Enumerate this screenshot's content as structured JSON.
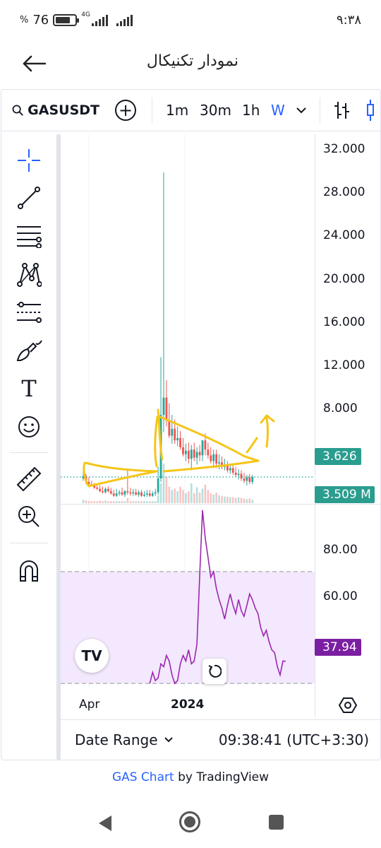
{
  "status_bar": {
    "time": "۹:۳۸",
    "battery": "76",
    "battery_percent_sign": "%",
    "battery_level": 0.76,
    "network": "4G"
  },
  "app_bar": {
    "title": "نمودار تکنیکال",
    "back_icon": "arrow-left-icon"
  },
  "toolbar": {
    "symbol": "GASUSDT",
    "intervals": [
      "1m",
      "30m",
      "1h",
      "W"
    ],
    "active_interval": "W",
    "icons": [
      "search-icon",
      "add-circle-icon",
      "chevron-down-icon",
      "bars-icon",
      "candles-icon"
    ]
  },
  "drawing_tools": [
    "crosshair-icon",
    "trendline-icon",
    "fib-retracement-icon",
    "pattern-icon",
    "prediction-icon",
    "brush-icon",
    "text-icon",
    "emoji-icon",
    "ruler-icon",
    "zoom-in-icon",
    "magnet-icon"
  ],
  "text_tool_label": "T",
  "chart_data": [
    {
      "type": "candlestick",
      "pane": "price",
      "y_ticks": [
        "32.000",
        "28.000",
        "24.000",
        "20.000",
        "16.000",
        "12.000",
        "8.000"
      ],
      "ylim": [
        1.3,
        33.3
      ],
      "x_ticks": [
        "Apr",
        "2024"
      ],
      "last_price": "3.626",
      "volume_label": "3.509 M",
      "up_color": "#26a69a",
      "down_color": "#ef5350",
      "price_tag_color": "#2a9d8f",
      "series": [
        {
          "name": "price",
          "x": [
            "2023-03-06",
            "2023-03-13",
            "2023-03-20",
            "2023-03-27",
            "2023-04-03",
            "2023-04-10",
            "2023-04-17",
            "2023-04-24",
            "2023-05-01",
            "2023-05-08",
            "2023-05-15",
            "2023-05-22",
            "2023-05-29",
            "2023-06-05",
            "2023-06-12",
            "2023-06-19",
            "2023-06-26",
            "2023-07-03",
            "2023-07-10",
            "2023-07-17",
            "2023-07-24",
            "2023-07-31",
            "2023-08-07",
            "2023-08-14",
            "2023-08-21",
            "2023-08-28",
            "2023-09-04",
            "2023-09-11",
            "2023-09-18",
            "2023-09-25",
            "2023-10-02",
            "2023-10-09",
            "2023-10-16",
            "2023-10-23",
            "2023-10-30",
            "2023-11-06",
            "2023-11-13",
            "2023-11-20",
            "2023-11-27",
            "2023-12-04",
            "2023-12-11",
            "2023-12-18",
            "2023-12-25",
            "2024-01-01",
            "2024-01-08",
            "2024-01-15",
            "2024-01-22",
            "2024-01-29",
            "2024-02-05",
            "2024-02-12",
            "2024-02-19",
            "2024-02-26",
            "2024-03-04",
            "2024-03-11",
            "2024-03-18",
            "2024-03-25",
            "2024-04-01",
            "2024-04-08",
            "2024-04-15",
            "2024-04-22",
            "2024-04-29",
            "2024-05-06"
          ],
          "open": [
            3.5,
            3.7,
            3.2,
            3.0,
            2.9,
            2.7,
            2.6,
            2.4,
            2.3,
            2.6,
            2.4,
            2.2,
            2.0,
            2.2,
            2.3,
            2.1,
            2.4,
            2.3,
            2.2,
            2.3,
            2.1,
            2.3,
            2.0,
            2.1,
            2.2,
            2.0,
            2.2,
            2.3,
            3.5,
            9.0,
            10.5,
            8.5,
            7.2,
            7.8,
            6.8,
            7.0,
            6.2,
            5.6,
            5.9,
            5.2,
            6.0,
            5.3,
            5.8,
            5.5,
            6.8,
            6.0,
            5.5,
            5.0,
            5.6,
            4.8,
            4.9,
            4.5,
            4.7,
            4.2,
            4.4,
            4.0,
            3.8,
            3.9,
            3.5,
            3.3,
            3.6,
            3.2
          ],
          "high": [
            4.3,
            3.9,
            3.6,
            3.3,
            3.1,
            3.0,
            2.9,
            2.8,
            2.7,
            2.8,
            2.7,
            2.5,
            2.6,
            2.5,
            2.7,
            2.5,
            4.2,
            2.7,
            2.6,
            2.6,
            2.5,
            2.5,
            2.4,
            2.5,
            2.5,
            2.4,
            2.6,
            4.5,
            14.0,
            30.0,
            12.0,
            10.0,
            9.0,
            8.6,
            8.0,
            7.6,
            7.0,
            6.5,
            6.6,
            6.4,
            6.6,
            6.2,
            6.4,
            6.6,
            7.4,
            6.6,
            6.2,
            6.0,
            6.0,
            5.6,
            5.4,
            5.2,
            5.0,
            4.8,
            4.8,
            4.5,
            4.3,
            4.2,
            4.0,
            3.8,
            3.9,
            3.8
          ],
          "low": [
            3.3,
            3.0,
            2.9,
            2.8,
            2.6,
            2.5,
            2.3,
            2.2,
            2.2,
            2.3,
            2.1,
            1.9,
            1.9,
            2.0,
            2.0,
            1.9,
            2.1,
            2.0,
            2.0,
            2.0,
            1.9,
            1.9,
            1.9,
            1.9,
            1.9,
            1.9,
            2.0,
            2.1,
            3.2,
            7.5,
            8.0,
            7.0,
            6.5,
            6.5,
            6.3,
            6.0,
            5.4,
            5.0,
            4.8,
            4.2,
            5.0,
            4.7,
            5.0,
            5.0,
            5.5,
            5.2,
            4.8,
            4.4,
            4.4,
            4.3,
            4.3,
            4.2,
            4.0,
            3.9,
            3.8,
            3.6,
            3.4,
            3.3,
            3.1,
            2.9,
            3.0,
            3.0
          ],
          "close": [
            3.7,
            3.2,
            3.0,
            2.9,
            2.7,
            2.6,
            2.4,
            2.3,
            2.6,
            2.4,
            2.2,
            2.0,
            2.2,
            2.3,
            2.1,
            2.4,
            2.3,
            2.2,
            2.3,
            2.1,
            2.3,
            2.0,
            2.1,
            2.2,
            2.0,
            2.2,
            2.3,
            3.5,
            9.0,
            10.5,
            8.5,
            7.2,
            7.8,
            6.8,
            7.0,
            6.2,
            5.6,
            5.9,
            5.2,
            6.0,
            5.3,
            5.8,
            5.5,
            6.8,
            6.0,
            5.5,
            5.0,
            5.6,
            4.8,
            4.9,
            4.5,
            4.7,
            4.2,
            4.4,
            4.0,
            3.8,
            3.9,
            3.5,
            3.3,
            3.6,
            3.2,
            3.626
          ]
        },
        {
          "name": "volume",
          "values": [
            0.5,
            0.4,
            0.3,
            0.3,
            0.3,
            0.3,
            0.4,
            0.3,
            0.4,
            0.3,
            0.3,
            0.3,
            0.3,
            0.3,
            0.3,
            0.3,
            0.8,
            0.3,
            0.3,
            0.3,
            0.3,
            0.3,
            0.3,
            0.3,
            0.3,
            0.3,
            0.3,
            1.2,
            3.0,
            6.0,
            4.0,
            2.5,
            2.0,
            2.2,
            1.8,
            2.5,
            2.0,
            1.5,
            1.8,
            3.0,
            1.5,
            2.4,
            1.6,
            2.2,
            2.8,
            2.0,
            1.5,
            1.3,
            1.6,
            1.2,
            1.1,
            1.0,
            1.0,
            0.9,
            0.9,
            0.8,
            0.9,
            0.8,
            0.7,
            0.6,
            0.7,
            0.5
          ]
        }
      ]
    },
    {
      "type": "line",
      "pane": "indicator",
      "y_ticks": [
        "80.00",
        "60.00"
      ],
      "ylim": [
        28,
        94
      ],
      "band": [
        70,
        30
      ],
      "band_color": "#f3e8fd",
      "line_color": "#9c27b0",
      "last_value": "37.94",
      "tag_color": "#7b1fa2",
      "series": [
        {
          "name": "indicator",
          "x_start_index": 24,
          "values": [
            30,
            34,
            31,
            32,
            37,
            36,
            40,
            38,
            33,
            30,
            31,
            37,
            40,
            38,
            42,
            37,
            38,
            44,
            69,
            92,
            82,
            75,
            68,
            70,
            64,
            60,
            57,
            53,
            58,
            62,
            58,
            55,
            60,
            56,
            54,
            58,
            62,
            60,
            57,
            55,
            50,
            47,
            49,
            45,
            42,
            41,
            36,
            33,
            38,
            37.94
          ]
        }
      ]
    }
  ],
  "price_line_color": "#26a69a",
  "annotation_color": "#f5c518",
  "bottom_bar": {
    "date_range_label": "Date Range",
    "time": "09:38:41 (UTC+3:30)"
  },
  "overlay": {
    "logo_text": "TV"
  },
  "footer": {
    "link_text": "GAS Chart",
    "by_text": "by TradingView"
  },
  "nav_bar": {
    "icons": [
      "nav-back-icon",
      "nav-home-icon",
      "nav-recents-icon"
    ]
  }
}
